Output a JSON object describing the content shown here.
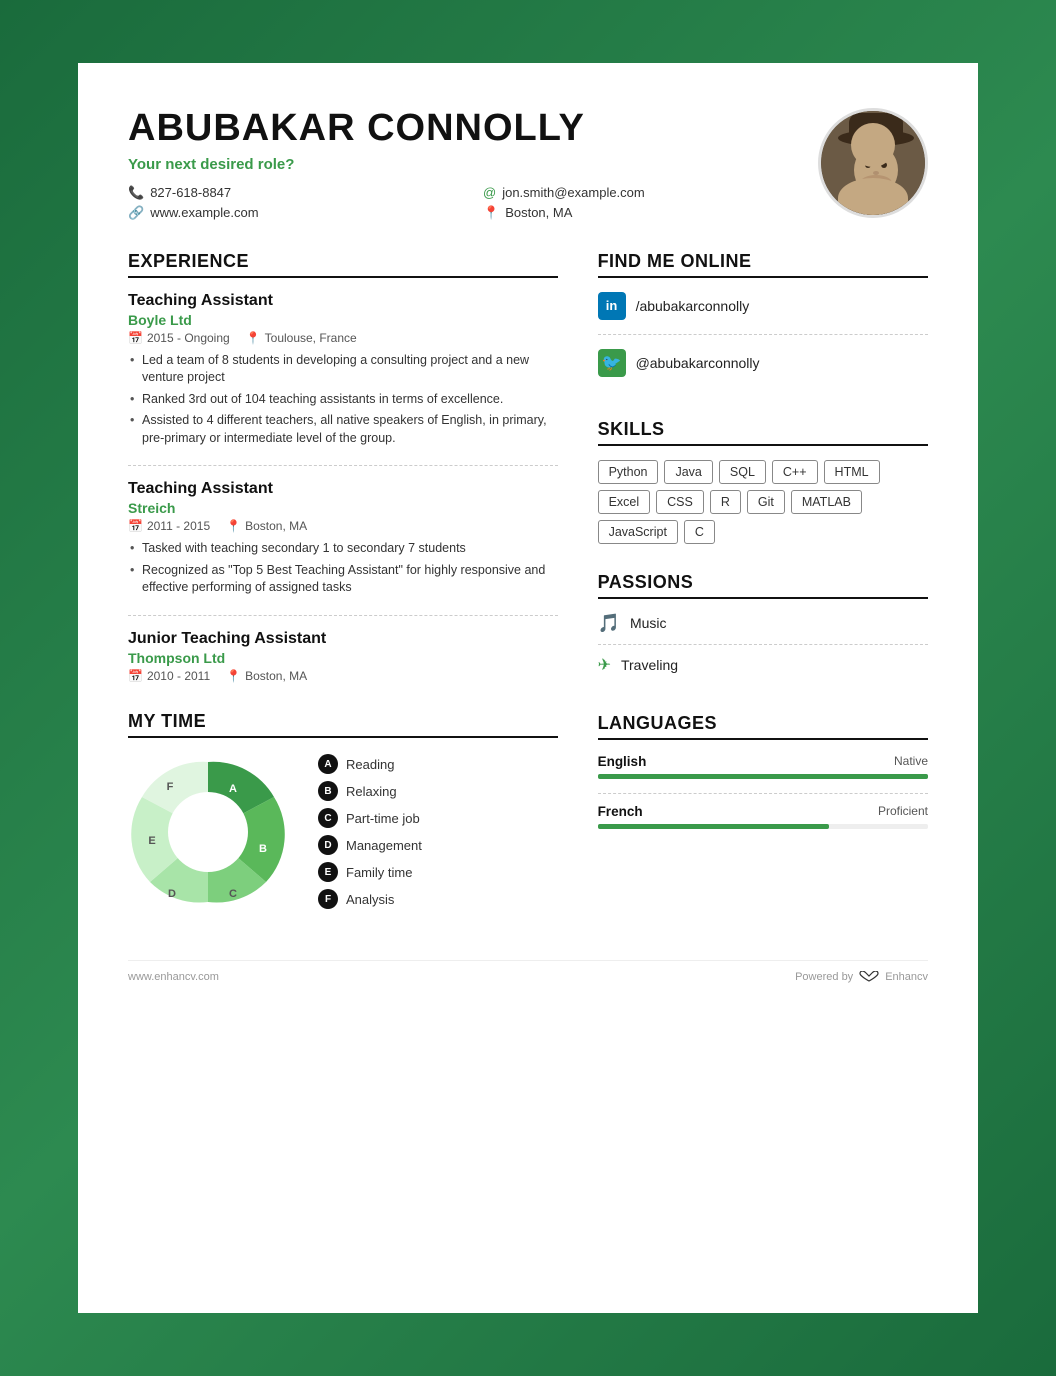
{
  "header": {
    "name": "ABUBAKAR CONNOLLY",
    "tagline": "Your next desired role?",
    "phone": "827-618-8847",
    "email": "jon.smith@example.com",
    "website": "www.example.com",
    "location": "Boston, MA"
  },
  "experience": {
    "section_title": "EXPERIENCE",
    "items": [
      {
        "title": "Teaching Assistant",
        "company": "Boyle Ltd",
        "dates": "2015 - Ongoing",
        "location": "Toulouse, France",
        "bullets": [
          "Led a team of 8 students in developing a consulting project and a new venture project",
          "Ranked 3rd out of 104 teaching assistants in terms of excellence.",
          "Assisted to 4 different teachers, all native speakers of English, in primary, pre-primary or intermediate level of the group."
        ]
      },
      {
        "title": "Teaching Assistant",
        "company": "Streich",
        "dates": "2011 - 2015",
        "location": "Boston, MA",
        "bullets": [
          "Tasked with teaching secondary 1 to secondary 7 students",
          "Recognized as \"Top 5 Best Teaching Assistant\" for highly responsive and effective performing of assigned tasks"
        ]
      },
      {
        "title": "Junior Teaching Assistant",
        "company": "Thompson Ltd",
        "dates": "2010 - 2011",
        "location": "Boston, MA",
        "bullets": []
      }
    ]
  },
  "mytime": {
    "section_title": "MY TIME",
    "legend": [
      {
        "label": "Reading",
        "letter": "A"
      },
      {
        "label": "Relaxing",
        "letter": "B"
      },
      {
        "label": "Part-time job",
        "letter": "C"
      },
      {
        "label": "Management",
        "letter": "D"
      },
      {
        "label": "Family time",
        "letter": "E"
      },
      {
        "label": "Analysis",
        "letter": "F"
      }
    ],
    "segments": [
      {
        "label": "A",
        "value": 22,
        "color": "#3a9a4a"
      },
      {
        "label": "B",
        "value": 18,
        "color": "#5ab85a"
      },
      {
        "label": "C",
        "value": 15,
        "color": "#7dcf7d"
      },
      {
        "label": "D",
        "value": 12,
        "color": "#a8e4a8"
      },
      {
        "label": "E",
        "value": 20,
        "color": "#c8f0c8"
      },
      {
        "label": "F",
        "value": 13,
        "color": "#e8f8e8"
      }
    ]
  },
  "find_me_online": {
    "section_title": "FIND ME ONLINE",
    "items": [
      {
        "platform": "linkedin",
        "handle": "/abubakarconnolly",
        "icon": "in"
      },
      {
        "platform": "twitter",
        "handle": "@abubakarconnolly",
        "icon": "🐦"
      }
    ]
  },
  "skills": {
    "section_title": "SKILLS",
    "items": [
      "Python",
      "Java",
      "SQL",
      "C++",
      "HTML",
      "Excel",
      "CSS",
      "R",
      "Git",
      "MATLAB",
      "JavaScript",
      "C"
    ]
  },
  "passions": {
    "section_title": "PASSIONS",
    "items": [
      {
        "label": "Music",
        "icon": "♪"
      },
      {
        "label": "Traveling",
        "icon": "✈"
      }
    ]
  },
  "languages": {
    "section_title": "LANGUAGES",
    "items": [
      {
        "name": "English",
        "level": "Native",
        "fill": 100
      },
      {
        "name": "French",
        "level": "Proficient",
        "fill": 70
      }
    ]
  },
  "footer": {
    "website": "www.enhancv.com",
    "powered_by": "Powered by",
    "brand": "Enhancv"
  }
}
